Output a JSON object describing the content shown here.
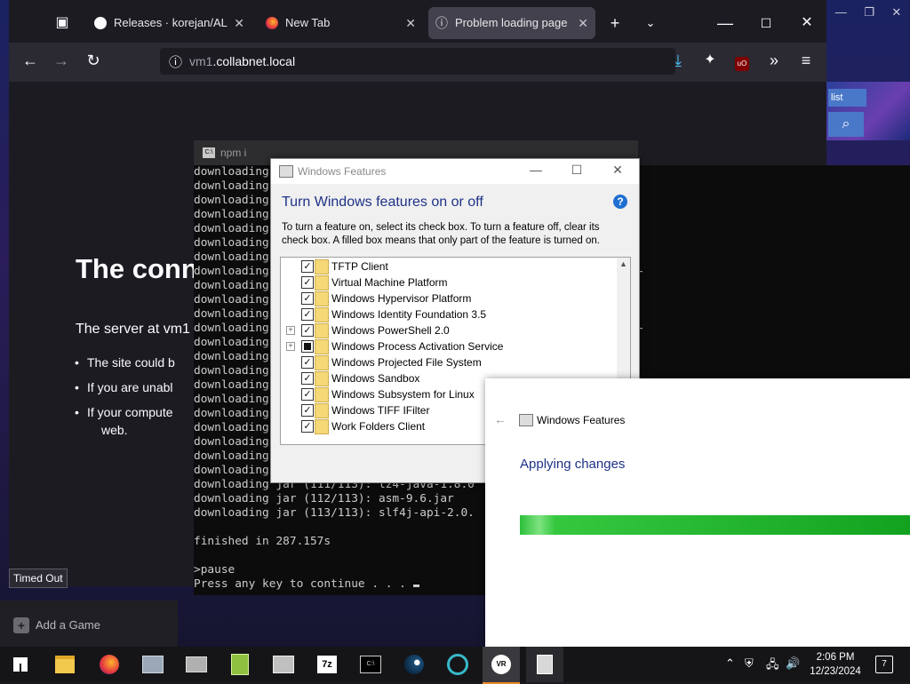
{
  "browser": {
    "tabs": [
      {
        "label": "Releases · korejan/ALXR-"
      },
      {
        "label": "New Tab"
      },
      {
        "label": "Problem loading page"
      }
    ],
    "url_prefix": "vm1",
    "url_domain": ".collabnet.local",
    "error": {
      "title": "The conn",
      "server_text": "The server at vm1",
      "bullets": [
        "The site could b",
        "If you are unabl",
        "If your compute",
        "web."
      ]
    },
    "status_tooltip": "Timed Out"
  },
  "desktop": {
    "right_label": "list"
  },
  "terminal": {
    "title": "npm i",
    "lines": [
      "downloading",
      "downloading",
      "downloading",
      "downloading",
      "downloading",
      "downloading",
      "downloading",
      "downloading",
      "downloading",
      "downloading",
      "downloading",
      "downloading",
      "downloading",
      "downloading",
      "downloading",
      "downloading",
      "downloading",
      "downloading",
      "downloading",
      "downloading",
      "downloading",
      "downloading",
      "downloading jar (111/113): lz4-java-1.8.0",
      "downloading jar (112/113): asm-9.6.jar",
      "downloading jar (113/113): slf4j-api-2.0.",
      "",
      "finished in 287.157s",
      "",
      ">pause",
      "Press any key to continue . . . "
    ],
    "right_frag_1": "ar",
    "right_frag_2": "ar"
  },
  "windows_features": {
    "title": "Windows Features",
    "heading": "Turn Windows features on or off",
    "help_glyph": "?",
    "description": "To turn a feature on, select its check box. To turn a feature off, clear its check box. A filled box means that only part of the feature is turned on.",
    "features": [
      {
        "name": "TFTP Client",
        "state": "checked",
        "expandable": false
      },
      {
        "name": "Virtual Machine Platform",
        "state": "checked",
        "expandable": false
      },
      {
        "name": "Windows Hypervisor Platform",
        "state": "checked",
        "expandable": false
      },
      {
        "name": "Windows Identity Foundation 3.5",
        "state": "checked",
        "expandable": false
      },
      {
        "name": "Windows PowerShell 2.0",
        "state": "checked",
        "expandable": true
      },
      {
        "name": "Windows Process Activation Service",
        "state": "partial",
        "expandable": true
      },
      {
        "name": "Windows Projected File System",
        "state": "checked",
        "expandable": false
      },
      {
        "name": "Windows Sandbox",
        "state": "checked",
        "expandable": false
      },
      {
        "name": "Windows Subsystem for Linux",
        "state": "checked",
        "expandable": false
      },
      {
        "name": "Windows TIFF IFilter",
        "state": "checked",
        "expandable": false
      },
      {
        "name": "Work Folders Client",
        "state": "checked",
        "expandable": false
      }
    ]
  },
  "applying": {
    "title": "Windows Features",
    "heading": "Applying changes",
    "progress_percent": 100
  },
  "launcher": {
    "add_game_label": "Add a Game"
  },
  "taskbar": {
    "clock_time": "2:06 PM",
    "clock_date": "12/23/2024",
    "notification_count": "7",
    "pinned": [
      "windows-start",
      "file-explorer",
      "firefox",
      "photos",
      "app-unknown",
      "notepad-plus-plus",
      "app-unknown-2",
      "7-zip",
      "command-prompt",
      "steam",
      "app-circle",
      "vr",
      "app-active"
    ],
    "colors": {
      "accent": "#e88a2a",
      "bar": "#151518"
    }
  }
}
